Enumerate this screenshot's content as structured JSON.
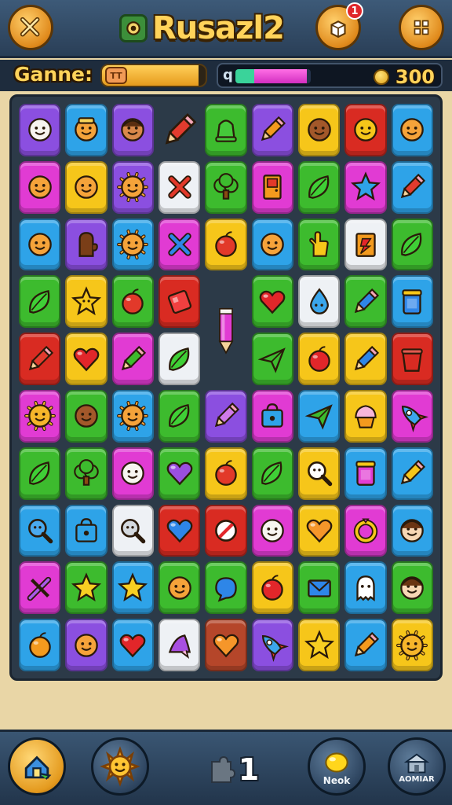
{
  "header": {
    "title": "Rusazl2",
    "notification_count": "1",
    "buttons": [
      "tools-icon",
      "gift-box-icon",
      "grid-menu-icon"
    ]
  },
  "status": {
    "game_label": "Ganne:",
    "level_icon_text": "TT",
    "level_progress_fraction": 0.93,
    "progress_glyph": "q",
    "progress_fraction": 0.95,
    "coin_count": "300"
  },
  "colors": {
    "purple": "#8b4fe0",
    "blue": "#2ea3e8",
    "green": "#3dbb2e",
    "red": "#d92b22",
    "yellow": "#f6c61a",
    "magenta": "#e13bd3",
    "white": "#eef1f5",
    "brown": "#b5462a"
  },
  "board": {
    "columns": 9,
    "rows": [
      [
        "purple:face-smile-white",
        "blue:face-hat",
        "purple:face-man",
        "empty:pencil-red",
        "green:bell-green",
        "purple:pencil-orange",
        "yellow:face-brown",
        "red:face-wink",
        "blue:face-orange"
      ],
      [
        "magenta:face-orange",
        "yellow:face-orange",
        "purple:sun-orange",
        "white:cross-red",
        "green:tree-green",
        "magenta:door-orange",
        "green:leaf-green",
        "magenta:star-blue",
        "blue:pencil-red"
      ],
      [
        "blue:face-orange",
        "purple:mitten-brown",
        "blue:sun-orange",
        "magenta:cross-blue",
        "yellow:balloon-red",
        "blue:face-orange",
        "green:hand-yellow",
        "white:card-red",
        "green:leaf-green"
      ],
      [
        "green:leaf-green",
        "yellow:star-face",
        "green:fruit-red",
        "red:flag-red",
        "empty:pencil-magenta-tall",
        "green:heart-red",
        "white:drop-blue",
        "green:pencil-blue",
        "blue:jar-blue"
      ],
      [
        "red:pencil-red",
        "yellow:heart-red",
        "magenta:pencil-green",
        "white:leaf-green",
        "empty:gap",
        "green:plane-green",
        "yellow:apple-red",
        "yellow:pencil-blue",
        "red:bucket-red"
      ],
      [
        "magenta:sun-face",
        "green:face-brown",
        "blue:sun-orange",
        "green:leaf-green",
        "purple:pencil-pink",
        "magenta:bag-blue",
        "blue:plane-green",
        "yellow:cupcake-pink",
        "magenta:rocket-blue"
      ],
      [
        "green:leaf-green",
        "green:tree-green",
        "magenta:face-smile-white",
        "green:heart-purple",
        "yellow:fruit-red",
        "green:leaf-green",
        "yellow:magnifier-white",
        "blue:jar-magenta",
        "blue:pencil-yellow"
      ],
      [
        "blue:magnifier-blue",
        "blue:bag-blue",
        "white:magnifier-gray",
        "red:heart-blue",
        "red:no-sign-white",
        "magenta:face-smile-white",
        "yellow:heart-orange",
        "magenta:ring-yellow",
        "blue:face-boy"
      ],
      [
        "magenta:wand-purple",
        "green:star-yellow",
        "blue:star-yellow",
        "green:face-orange",
        "green:bubble-blue",
        "yellow:apple-red",
        "green:envelope-blue",
        "blue:ghost-white",
        "green:face-boy"
      ],
      [
        "blue:fruit-orange",
        "purple:face-orange",
        "blue:heart-red",
        "white:hat-purple",
        "brown:heart-orange",
        "purple:rocket-blue",
        "yellow:star-yellow",
        "blue:pencil-orange",
        "yellow:sun-face"
      ]
    ]
  },
  "footer": {
    "home_button": "home-icon",
    "booster_button": "sun-booster-icon",
    "moves_count": "1",
    "next_label": "Neok",
    "menu_label": "AOMIAR"
  }
}
